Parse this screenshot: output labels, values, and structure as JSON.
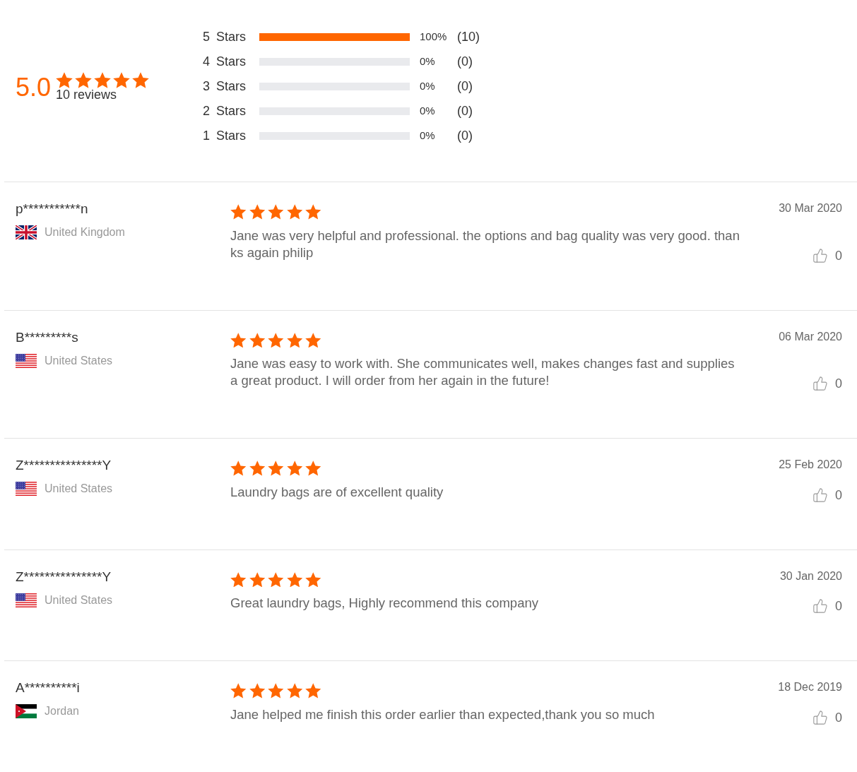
{
  "summary": {
    "rating": "5.0",
    "stars": 5,
    "reviews_label": "10 reviews"
  },
  "distribution": [
    {
      "label": "5 Stars",
      "level": 1,
      "percent": "100%",
      "count": "(10)"
    },
    {
      "label": "4 Stars",
      "level": 0,
      "percent": "0%",
      "count": "(0)"
    },
    {
      "label": "3 Stars",
      "level": 0,
      "percent": "0%",
      "count": "(0)"
    },
    {
      "label": "2 Stars",
      "level": 0,
      "percent": "0%",
      "count": "(0)"
    },
    {
      "label": "1 Stars",
      "level": 0,
      "percent": "0%",
      "count": "(0)"
    }
  ],
  "reviews": [
    {
      "name": "p***********n",
      "country": {
        "label": "United Kingdom",
        "kind": "gb"
      },
      "stars": 5,
      "lines": [
        "Jane was very helpful and professional. the options and bag quality was very good. than",
        "ks again philip"
      ],
      "date": "30 Mar 2020",
      "likes": "0"
    },
    {
      "name": "B*********s",
      "country": {
        "label": "United States",
        "kind": "us"
      },
      "stars": 5,
      "lines": [
        "Jane was easy to work with. She communicates well, makes changes fast and supplies",
        "a great product. I will order from her again in the future!"
      ],
      "date": "06 Mar 2020",
      "likes": "0"
    },
    {
      "name": "Z***************Y",
      "country": {
        "label": "United States",
        "kind": "us"
      },
      "stars": 5,
      "lines": [
        "Laundry bags are of excellent quality"
      ],
      "date": "25 Feb 2020",
      "likes": "0"
    },
    {
      "name": "Z***************Y",
      "country": {
        "label": "United States",
        "kind": "us"
      },
      "stars": 5,
      "lines": [
        "Great laundry bags, Highly recommend this company"
      ],
      "date": "30 Jan 2020",
      "likes": "0"
    },
    {
      "name": "A**********i",
      "country": {
        "label": "Jordan",
        "kind": "jo"
      },
      "stars": 5,
      "lines": [
        "Jane helped me finish this order earlier than expected,thank you so much"
      ],
      "date": "18 Dec 2019",
      "likes": "0"
    }
  ]
}
